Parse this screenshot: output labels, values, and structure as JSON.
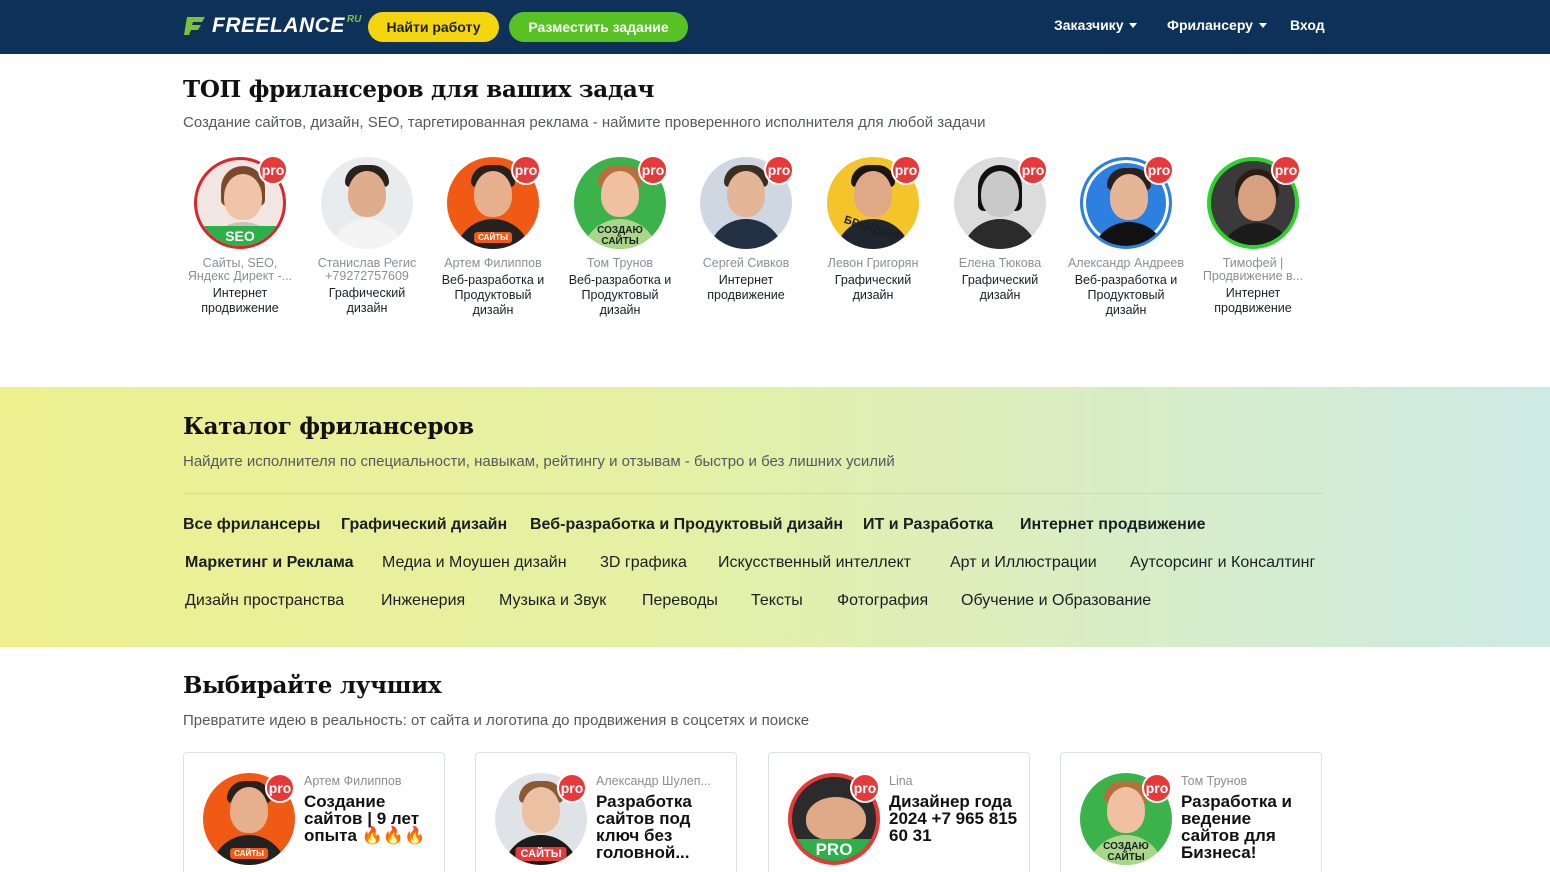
{
  "header": {
    "logo_text": "FREELANCE",
    "logo_suffix": "RU",
    "find_work": "Найти работу",
    "post_task": "Разместить задание",
    "nav_customer": "Заказчику",
    "nav_freelancer": "Фрилансеру",
    "nav_login": "Вход"
  },
  "top": {
    "title": "ТОП фрилансеров для ваших задач",
    "subtitle": "Создание сайтов, дизайн, SEO, таргетированная реклама - наймите проверенного исполнителя для любой задачи",
    "pro_label": "pro",
    "freelancers": [
      {
        "name": "Сайты, SEO, Яндекс Директ -...",
        "spec": "Интернет продвижение",
        "tag": "SEO"
      },
      {
        "name": "Станислав Регис +79272757609",
        "spec": "Графический дизайн",
        "tag": ""
      },
      {
        "name": "Артем Филиппов",
        "spec": "Веб-разработка и Продуктовый дизайн",
        "tag": "САЙТЫ"
      },
      {
        "name": "Том Трунов",
        "spec": "Веб-разработка и Продуктовый дизайн",
        "tag": "СОЗДАЮ САЙТЫ"
      },
      {
        "name": "Сергей Сивков",
        "spec": "Интернет продвижение",
        "tag": ""
      },
      {
        "name": "Левон Григорян",
        "spec": "Графический дизайн",
        "tag": "БРЕНДИНГ"
      },
      {
        "name": "Елена Тюкова",
        "spec": "Графический дизайн",
        "tag": ""
      },
      {
        "name": "Александр Андреев",
        "spec": "Веб-разработка и Продуктовый дизайн",
        "tag": ""
      },
      {
        "name": "Тимофей | Продвижение в...",
        "spec": "Интернет продвижение",
        "tag": ""
      }
    ]
  },
  "catalog": {
    "title": "Каталог фрилансеров",
    "subtitle": "Найдите исполнителя по специальности, навыкам, рейтингу и отзывам - быстро и без лишних усилий",
    "row1": [
      "Все фрилансеры",
      "Графический дизайн",
      "Веб-разработка и Продуктовый дизайн",
      "ИТ и Разработка",
      "Интернет продвижение"
    ],
    "row2": [
      "Маркетинг и Реклама",
      "Медиа и Моушен дизайн",
      "3D графика",
      "Искусственный интеллект",
      "Арт и Иллюстрации",
      "Аутсорсинг и Консалтинг"
    ],
    "row3": [
      "Дизайн пространства",
      "Инженерия",
      "Музыка и Звук",
      "Переводы",
      "Тексты",
      "Фотография",
      "Обучение и Образование"
    ]
  },
  "best": {
    "title": "Выбирайте лучших",
    "subtitle": "Превратите идею в реальность: от сайта и логотипа до продвижения в соцсетях и поиске",
    "cards": [
      {
        "name": "Артем Филиппов",
        "title": "Создание сайтов | 9 лет опыта 🔥🔥🔥",
        "tag": "САЙТЫ"
      },
      {
        "name": "Александр Шулеп...",
        "title": "Разработка сайтов под ключ без головной...",
        "tag": "САЙТЫ"
      },
      {
        "name": "Lina",
        "title": "Дизайнер года 2024 +7 965 815 60 31",
        "tag": "PRO"
      },
      {
        "name": "Том Трунов",
        "title": "Разработка и ведение сайтов для Бизнеса!",
        "tag": "СОЗДАЮ САЙТЫ"
      }
    ]
  },
  "colors": {
    "header_bg": "#0d3158",
    "find_btn": "#f5d60e",
    "post_btn": "#58c224",
    "pro_badge": "#e63a3a"
  }
}
